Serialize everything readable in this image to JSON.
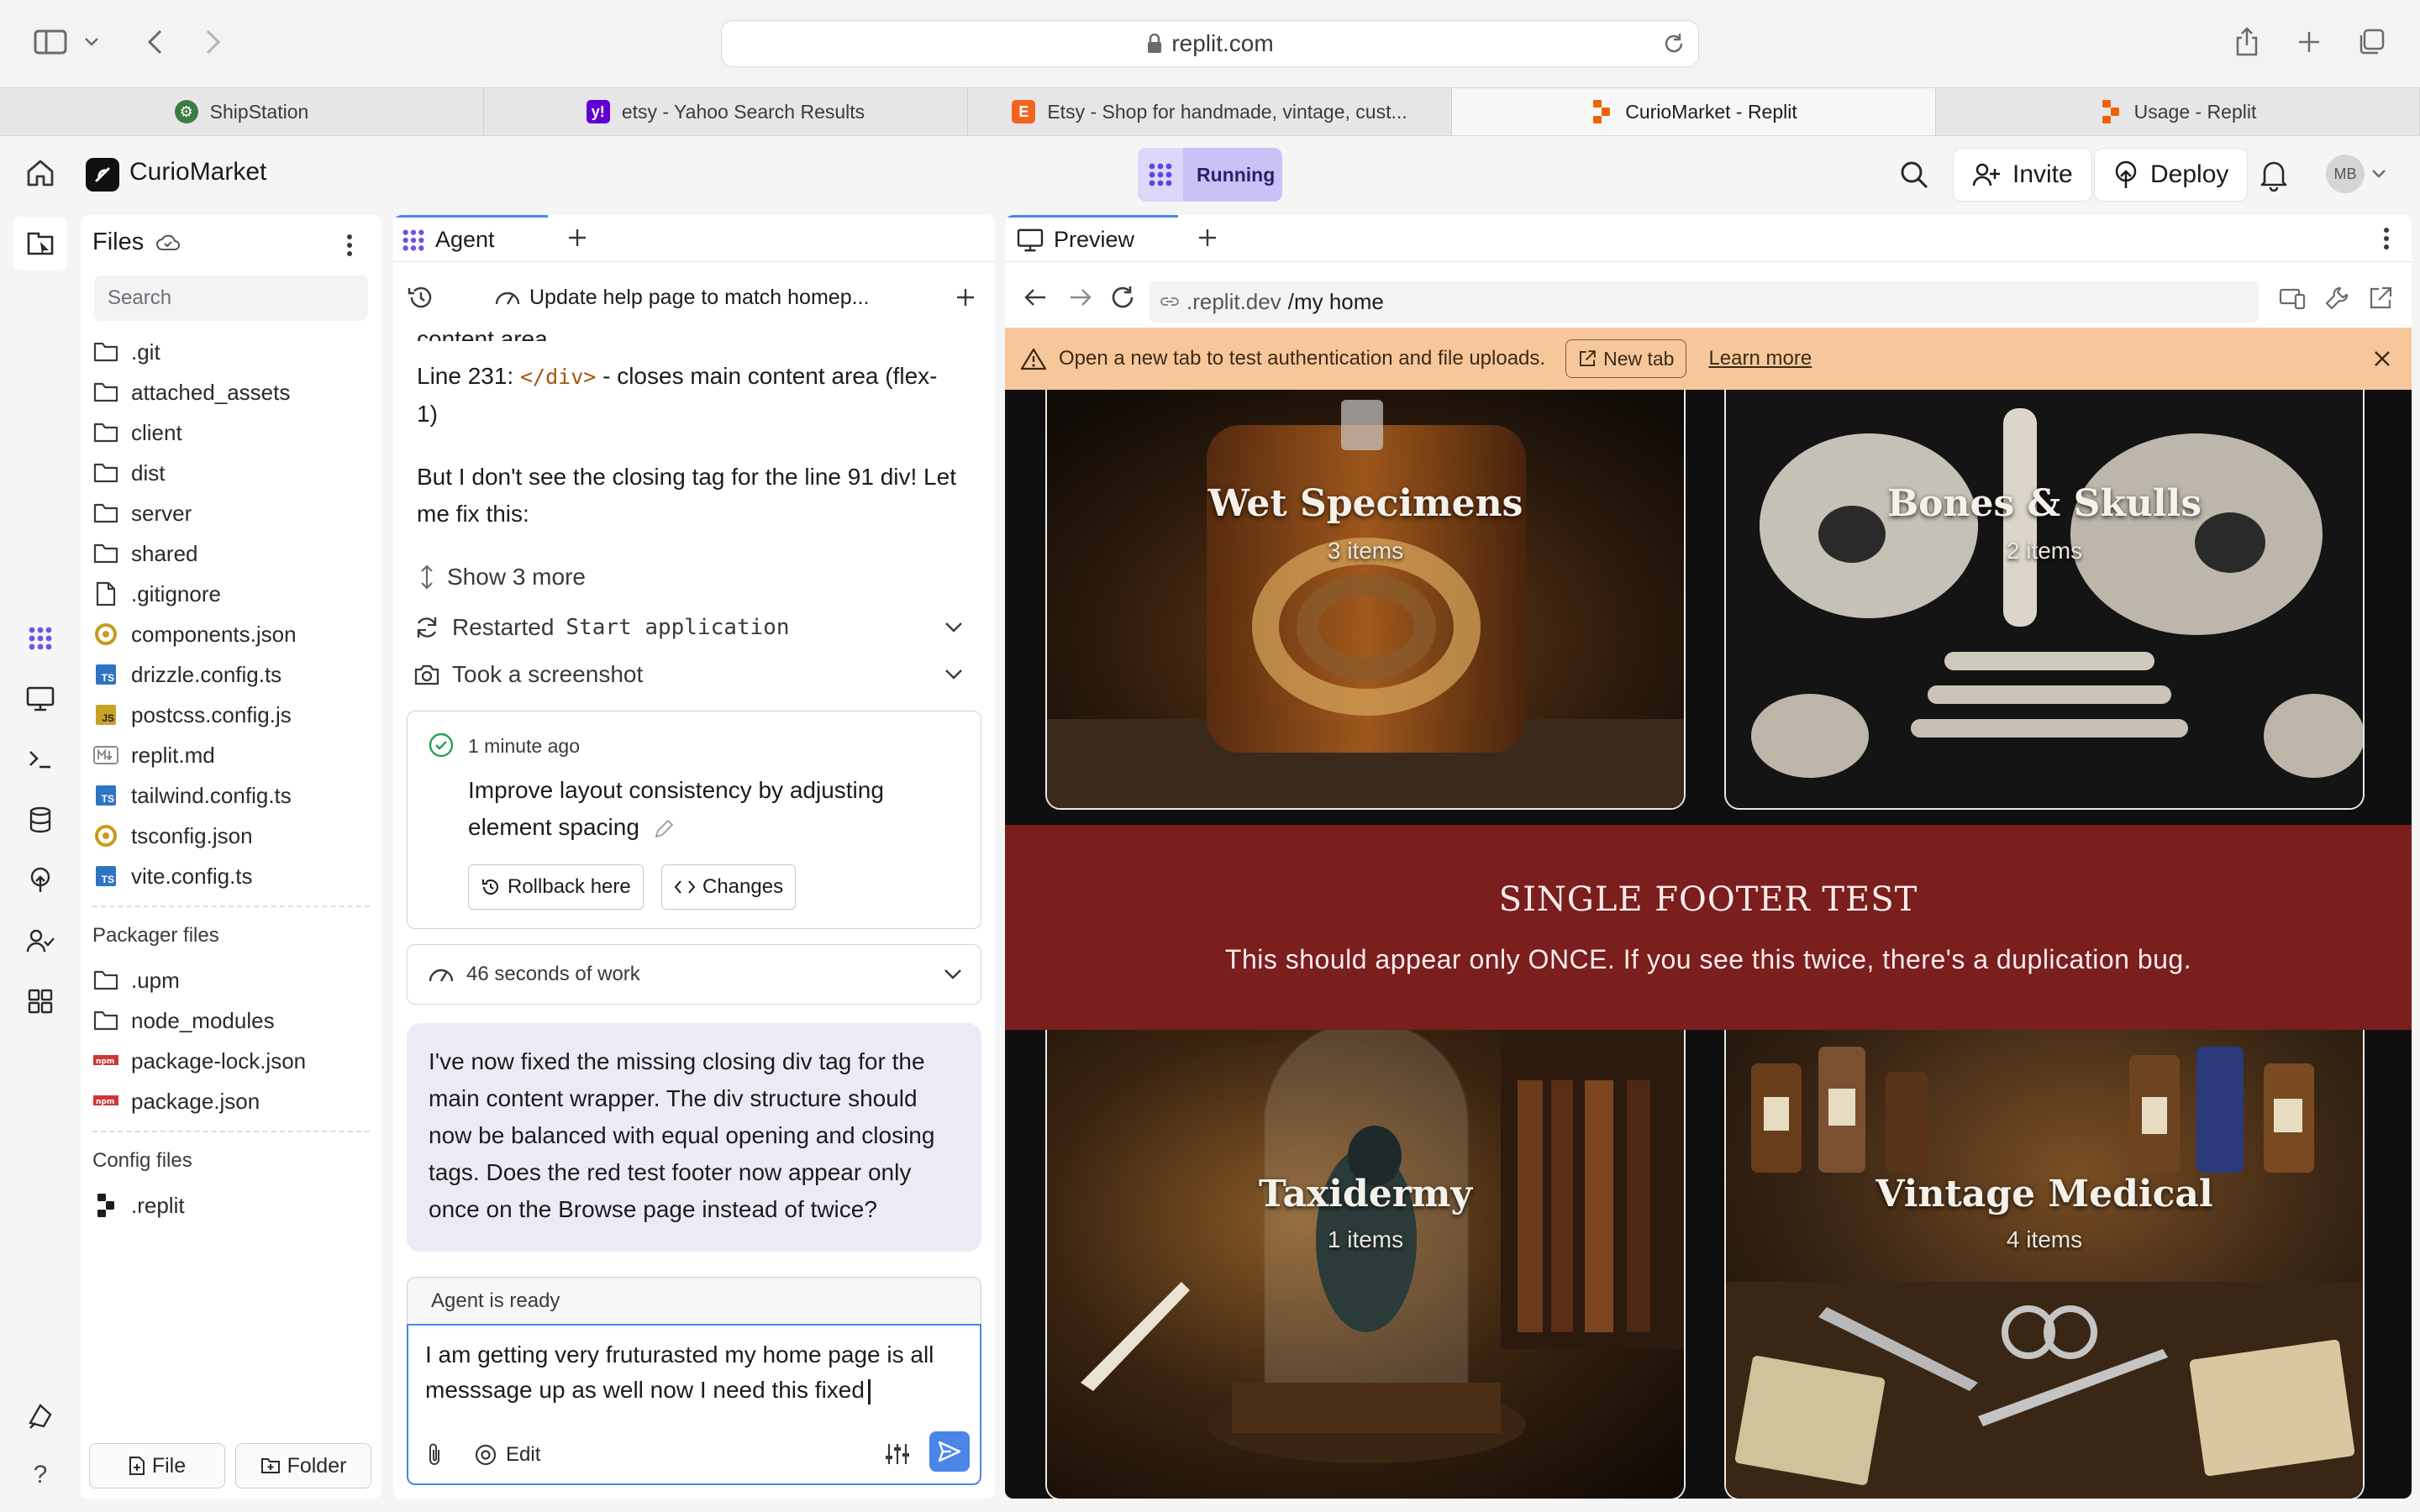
{
  "browser": {
    "address": "replit.com",
    "tabs": [
      {
        "label": "ShipStation",
        "icon": "gear-icon"
      },
      {
        "label": "etsy - Yahoo Search Results",
        "icon": "yahoo-icon"
      },
      {
        "label": "Etsy - Shop for handmade, vintage, cust...",
        "icon": "etsy-icon"
      },
      {
        "label": "CurioMarket - Replit",
        "icon": "replit-icon",
        "active": true
      },
      {
        "label": "Usage - Replit",
        "icon": "replit-icon"
      }
    ]
  },
  "app": {
    "name": "CurioMarket",
    "run_status": "Running",
    "invite_label": "Invite",
    "deploy_label": "Deploy",
    "avatar_initials": "MB"
  },
  "files": {
    "title": "Files",
    "search_placeholder": "Search",
    "items": [
      {
        "name": ".git",
        "type": "folder"
      },
      {
        "name": "attached_assets",
        "type": "folder"
      },
      {
        "name": "client",
        "type": "folder"
      },
      {
        "name": "dist",
        "type": "folder"
      },
      {
        "name": "server",
        "type": "folder"
      },
      {
        "name": "shared",
        "type": "folder"
      },
      {
        "name": ".gitignore",
        "type": "file"
      },
      {
        "name": "components.json",
        "type": "json"
      },
      {
        "name": "drizzle.config.ts",
        "type": "ts"
      },
      {
        "name": "postcss.config.js",
        "type": "js"
      },
      {
        "name": "replit.md",
        "type": "md"
      },
      {
        "name": "tailwind.config.ts",
        "type": "ts"
      },
      {
        "name": "tsconfig.json",
        "type": "json"
      },
      {
        "name": "vite.config.ts",
        "type": "ts"
      }
    ],
    "packager_label": "Packager files",
    "packager_items": [
      {
        "name": ".upm",
        "type": "folder"
      },
      {
        "name": "node_modules",
        "type": "folder"
      },
      {
        "name": "package-lock.json",
        "type": "npm"
      },
      {
        "name": "package.json",
        "type": "npm"
      }
    ],
    "config_label": "Config files",
    "config_items": [
      {
        "name": ".replit",
        "type": "replit"
      }
    ],
    "new_file_label": "File",
    "new_folder_label": "Folder"
  },
  "agent": {
    "tab_label": "Agent",
    "thread_title": "Update help page to match homep...",
    "msg_fragment": "content area",
    "line231_prefix": "Line 231:",
    "line231_code": "</div>",
    "line231_suffix": "- closes main content area (flex-",
    "line231_wrap": "1)",
    "msg_closing": "But I don't see the closing tag for the line 91 div! Let me fix this:",
    "show_more": "Show 3 more",
    "restarted_label": "Restarted",
    "restarted_target": "Start application",
    "screenshot_label": "Took a screenshot",
    "checkpoint": {
      "time": "1 minute ago",
      "summary": "Improve layout consistency by adjusting element spacing",
      "rollback_label": "Rollback here",
      "changes_label": "Changes"
    },
    "work_duration": "46 seconds of work",
    "reply": "I've now fixed the missing closing div tag for the main content wrapper. The div structure should now be balanced with equal opening and closing tags. Does the red test footer now appear only once on the Browse page instead of twice?",
    "status": "Agent is ready",
    "draft": "I am getting very fruturasted my home page is all messsage up as well now I need this fixed",
    "edit_label": "Edit"
  },
  "preview": {
    "tab_label": "Preview",
    "url_prefix": ".replit.dev",
    "url_path": "/my home",
    "warning": "Open a new tab to test authentication and file uploads.",
    "new_tab_label": "New tab",
    "learn_more": "Learn more",
    "categories": [
      {
        "title": "Wet Specimens",
        "count": "3 items"
      },
      {
        "title": "Bones & Skulls",
        "count": "2 items"
      },
      {
        "title": "Taxidermy",
        "count": "1 items"
      },
      {
        "title": "Vintage Medical",
        "count": "4 items"
      }
    ],
    "footer_title": "SINGLE FOOTER TEST",
    "footer_text": "This should appear only ONCE. If you see this twice, there's a duplication bug.",
    "colors": {
      "footer_bg": "#7a1e1e",
      "warning_bg": "#f6c79a",
      "accent": "#4a86e8",
      "running_bg": "#c9c2f7"
    }
  }
}
